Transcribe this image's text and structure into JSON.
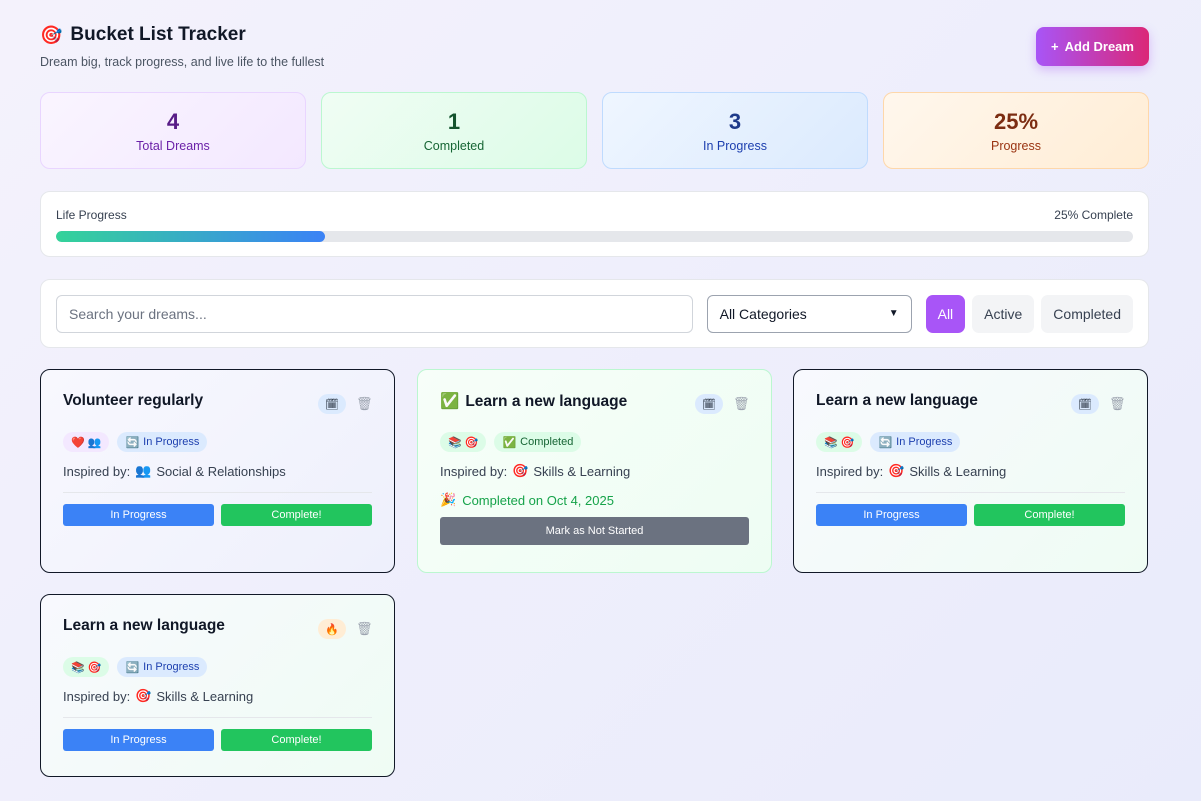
{
  "header": {
    "icon": "target-icon",
    "icon_glyph": "🎯",
    "title": "Bucket List Tracker",
    "subtitle": "Dream big, track progress, and live life to the fullest",
    "add_button_icon": "+",
    "add_button_label": "Add Dream"
  },
  "stats": [
    {
      "value": "4",
      "label": "Total Dreams"
    },
    {
      "value": "1",
      "label": "Completed"
    },
    {
      "value": "3",
      "label": "In Progress"
    },
    {
      "value": "25%",
      "label": "Progress"
    }
  ],
  "progress": {
    "label": "Life Progress",
    "status_text": "25% Complete",
    "fraction": 0.25
  },
  "filters": {
    "search_placeholder": "Search your dreams...",
    "category_selected": "All Categories",
    "buttons": [
      "All",
      "Active",
      "Completed"
    ],
    "active_button": "All"
  },
  "cards": [
    {
      "title": "Volunteer regularly",
      "title_icon": "",
      "action_icon": "🗓",
      "category_icons": "❤️ 👥",
      "status_icon": "🔄",
      "status": "In Progress",
      "inspired_label": "Inspired by:",
      "inspired_icon": "👥",
      "inspired_value": "Social & Relationships",
      "btn_progress": "In Progress",
      "btn_complete": "Complete!"
    },
    {
      "title": "Learn a new language",
      "title_icon": "✅",
      "action_icon": "🗓",
      "category_icons": "📚 🎯",
      "status_icon": "✅",
      "status": "Completed",
      "inspired_label": "Inspired by:",
      "inspired_icon": "🎯",
      "inspired_value": "Skills & Learning",
      "completed_icon": "🎉",
      "completed_text": "Completed on Oct 4, 2025",
      "btn_reset": "Mark as Not Started"
    },
    {
      "title": "Learn a new language",
      "title_icon": "",
      "action_icon": "🗓",
      "category_icons": "📚 🎯",
      "status_icon": "🔄",
      "status": "In Progress",
      "inspired_label": "Inspired by:",
      "inspired_icon": "🎯",
      "inspired_value": "Skills & Learning",
      "btn_progress": "In Progress",
      "btn_complete": "Complete!"
    },
    {
      "title": "Learn a new language",
      "title_icon": "",
      "action_icon": "🔥",
      "category_icons": "📚 🎯",
      "status_icon": "🔄",
      "status": "In Progress",
      "inspired_label": "Inspired by:",
      "inspired_icon": "🎯",
      "inspired_value": "Skills & Learning",
      "btn_progress": "In Progress",
      "btn_complete": "Complete!"
    }
  ],
  "trash_glyph": "🗑",
  "colors": {
    "accent": "#a855f7",
    "progress_blue": "#3b82f6",
    "complete_green": "#22c55e"
  }
}
